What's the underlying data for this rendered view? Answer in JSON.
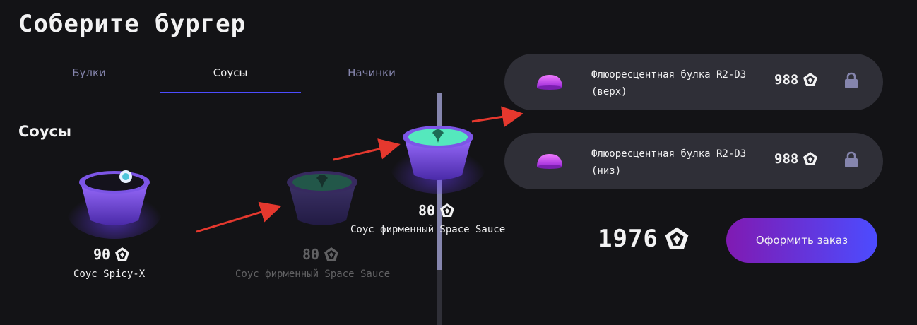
{
  "page": {
    "title": "Соберите бургер"
  },
  "tabs": [
    {
      "label": "Булки"
    },
    {
      "label": "Соусы"
    },
    {
      "label": "Начинки"
    }
  ],
  "active_tab": "Соусы",
  "section": {
    "title": "Соусы"
  },
  "cards": [
    {
      "price": "90",
      "name": "Соус Spicy-X",
      "state": "normal"
    },
    {
      "price": "80",
      "name": "Соус фирменный Space Sauce",
      "state": "faded (being dragged)"
    },
    {
      "price": "80",
      "name": "Соус фирменный Space Sauce",
      "state": "dragged"
    }
  ],
  "constructor": {
    "items": [
      {
        "name": "Флюоресцентная булка R2-D3 (верх)",
        "price": "988",
        "locked": true
      },
      {
        "name": "Флюоресцентная булка R2-D3 (низ)",
        "price": "988",
        "locked": true
      }
    ],
    "total": "1976",
    "order_button": "Оформить заказ"
  },
  "colors": {
    "background": "#131316",
    "panel": "#2f2f37",
    "accent": "#4c4cff",
    "button_gradient_start": "#801ab2",
    "annotation_arrow": "#e5382e"
  },
  "icons": [
    "currency-icon",
    "lock-icon",
    "bun-icon",
    "sauce-icon"
  ]
}
